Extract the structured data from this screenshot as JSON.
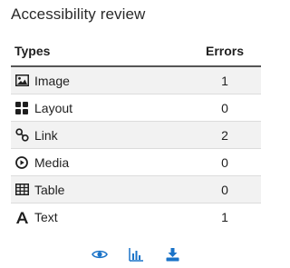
{
  "title": "Accessibility review",
  "table": {
    "headers": {
      "type": "Types",
      "errors": "Errors"
    },
    "rows": [
      {
        "type": "Image",
        "errors": "1",
        "icon": "image-icon"
      },
      {
        "type": "Layout",
        "errors": "0",
        "icon": "layout-icon"
      },
      {
        "type": "Link",
        "errors": "2",
        "icon": "link-icon"
      },
      {
        "type": "Media",
        "errors": "0",
        "icon": "media-icon"
      },
      {
        "type": "Table",
        "errors": "0",
        "icon": "table-icon"
      },
      {
        "type": "Text",
        "errors": "1",
        "icon": "text-icon"
      }
    ]
  },
  "footer": {
    "buttons": [
      {
        "icon": "eye-icon"
      },
      {
        "icon": "bar-chart-icon"
      },
      {
        "icon": "download-icon"
      }
    ]
  },
  "colors": {
    "accent": "#1a73c8",
    "text": "#1f1f1f",
    "stripe": "#f2f2f2",
    "header_rule": "#555555"
  }
}
